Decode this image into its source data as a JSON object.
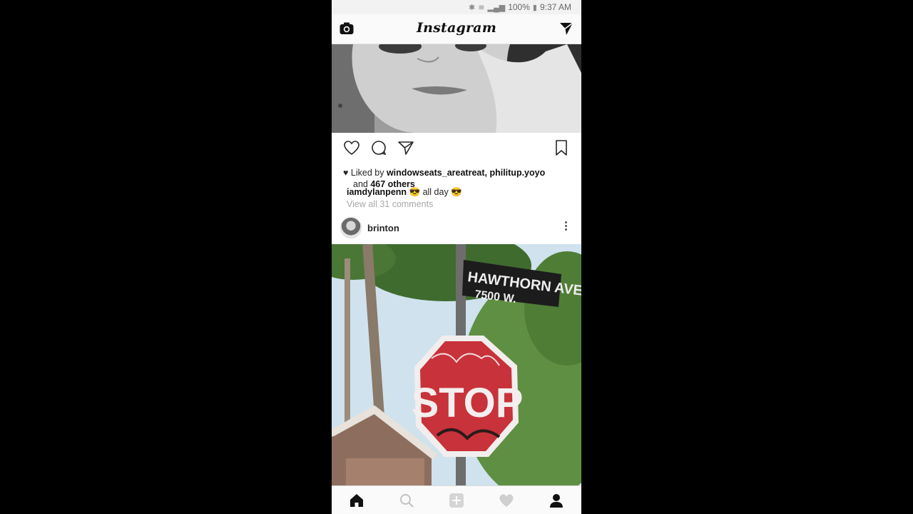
{
  "status_bar": {
    "bluetooth_icon": "bluetooth-icon",
    "wifi_icon": "wifi-icon",
    "signal_icon": "signal-icon",
    "battery_percent": "100%",
    "battery_icon": "battery-icon",
    "time": "9:37 AM"
  },
  "app_bar": {
    "title": "Instagram"
  },
  "post1": {
    "liked_by_prefix": "Liked by",
    "liked_users": "windowseats_areatreat, philitup.yoyo",
    "and_text": "and",
    "others": "467 others",
    "caption_user": "iamdylanpenn",
    "caption_text": "😎 all day 😎",
    "view_comments": "View all 31 comments"
  },
  "post2": {
    "username": "brinton",
    "image_alt": "street sign photo"
  },
  "photo_text": {
    "street_sign_line1": "HAWTHORN AVE.",
    "street_sign_line2": "7500 W.",
    "stop": "STOP"
  },
  "colors": {
    "stop_red": "#c8323a",
    "sign_black": "#1c1c1c",
    "tree_green": "#6a9a4a",
    "bg": "#000000"
  }
}
